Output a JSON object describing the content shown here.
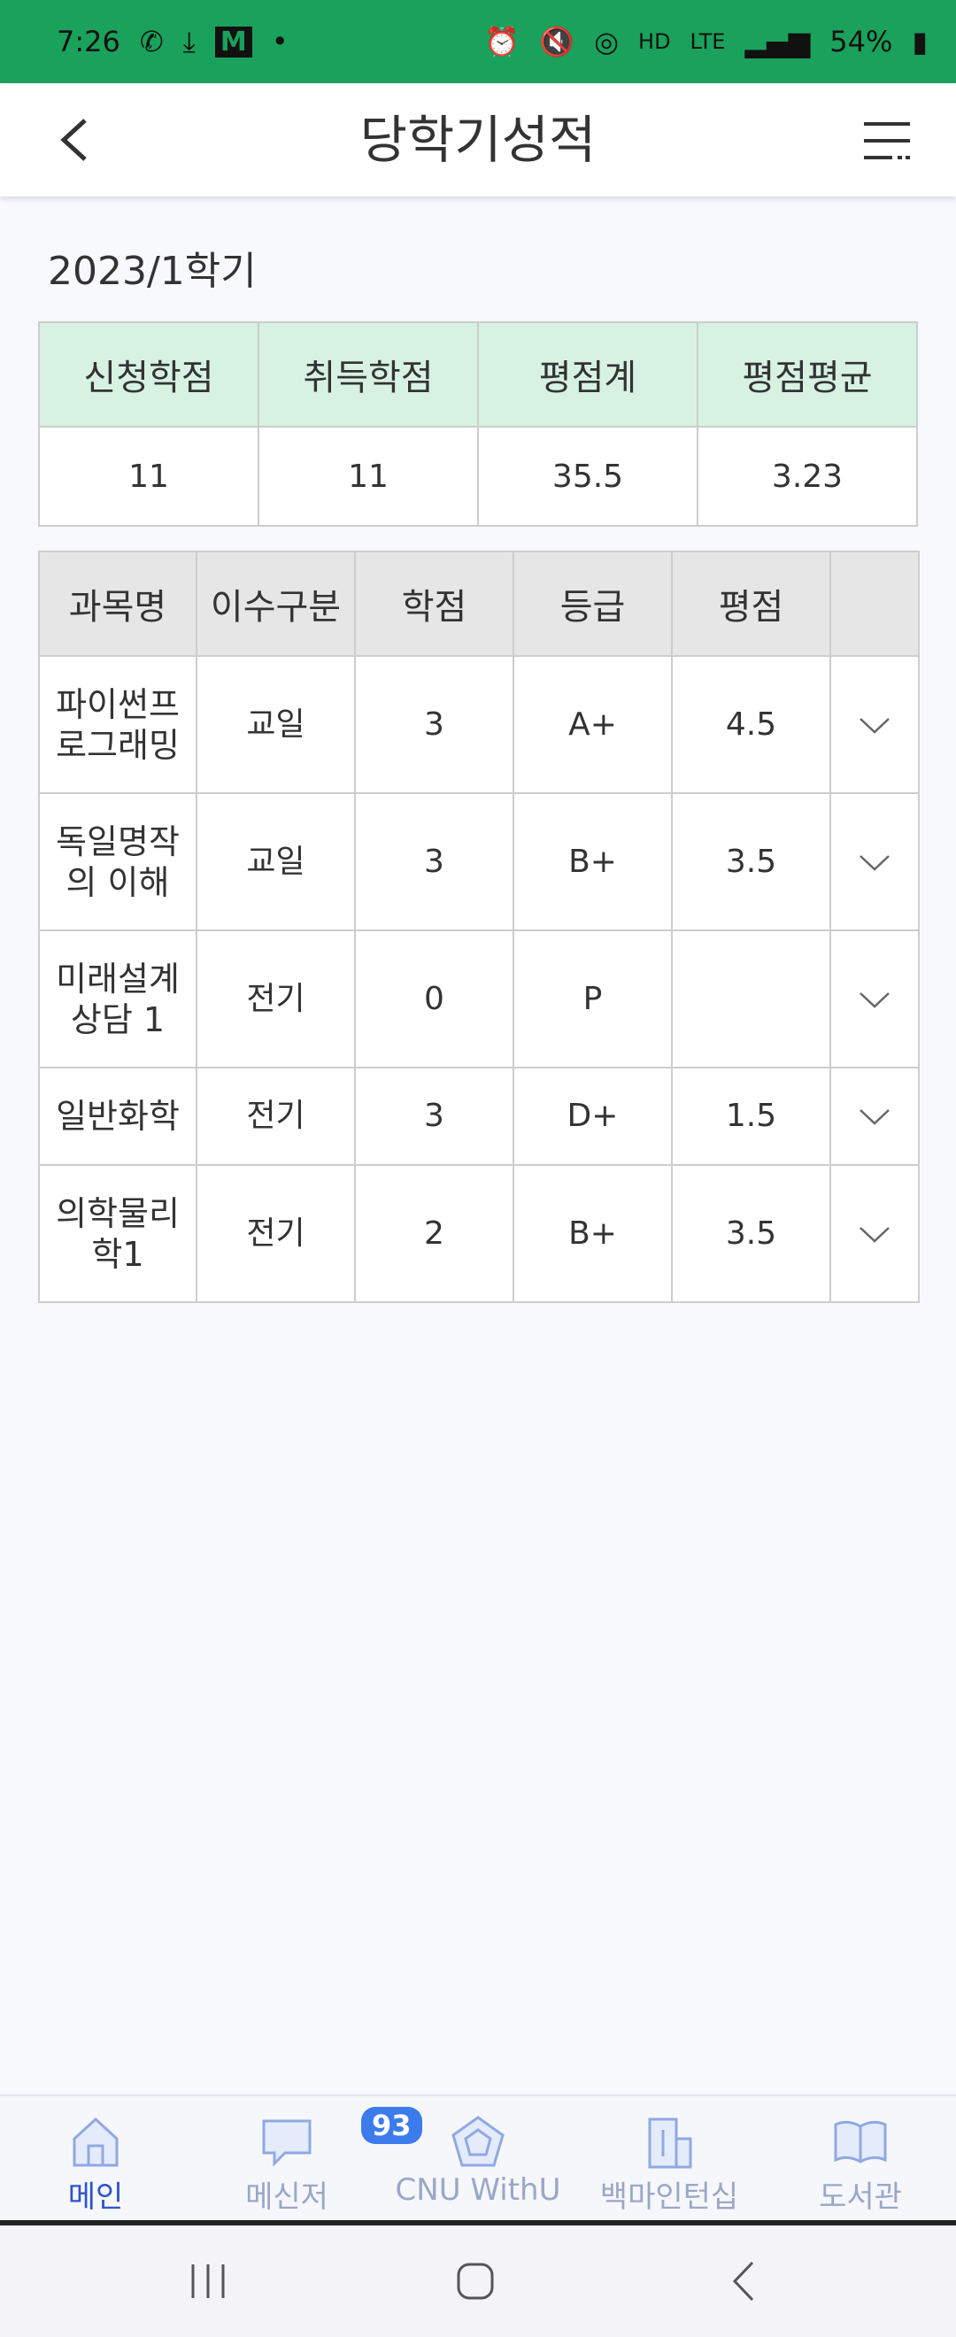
{
  "status_bar": {
    "time": "7:26",
    "mail_badge": "M",
    "hd": "HD",
    "lte": "LTE",
    "battery": "54%"
  },
  "header": {
    "title": "당학기성적"
  },
  "semester": "2023/1학기",
  "summary": {
    "headers": [
      "신청학점",
      "취득학점",
      "평점계",
      "평점평균"
    ],
    "values": [
      "11",
      "11",
      "35.5",
      "3.23"
    ]
  },
  "grades": {
    "headers": [
      "과목명",
      "이수구분",
      "학점",
      "등급",
      "평점",
      ""
    ],
    "rows": [
      {
        "name_line1": "파이썬프",
        "name_line2": "로그래밍",
        "category": "교일",
        "credit": "3",
        "grade": "A+",
        "point": "4.5"
      },
      {
        "name_line1": "독일명작",
        "name_line2": "의 이해",
        "category": "교일",
        "credit": "3",
        "grade": "B+",
        "point": "3.5"
      },
      {
        "name_line1": "미래설계",
        "name_line2": "상담 1",
        "category": "전기",
        "credit": "0",
        "grade": "P",
        "point": ""
      },
      {
        "name_line1": "일반화학",
        "name_line2": "",
        "category": "전기",
        "credit": "3",
        "grade": "D+",
        "point": "1.5"
      },
      {
        "name_line1": "의학물리",
        "name_line2": "학1",
        "category": "전기",
        "credit": "2",
        "grade": "B+",
        "point": "3.5"
      }
    ]
  },
  "bottom_nav": {
    "items": [
      {
        "label": "메인",
        "icon": "home-icon"
      },
      {
        "label": "메신저",
        "icon": "chat-icon",
        "badge": "93"
      },
      {
        "label": "CNU WithU",
        "icon": "pentagon-icon"
      },
      {
        "label": "백마인턴십",
        "icon": "building-icon"
      },
      {
        "label": "도서관",
        "icon": "book-icon"
      }
    ]
  },
  "colors": {
    "status_bar": "#1aa15b",
    "summary_header": "#d7f2e3",
    "grades_header": "#e6e6e6",
    "nav_active": "#2f54c7",
    "badge": "#3b7bec"
  }
}
